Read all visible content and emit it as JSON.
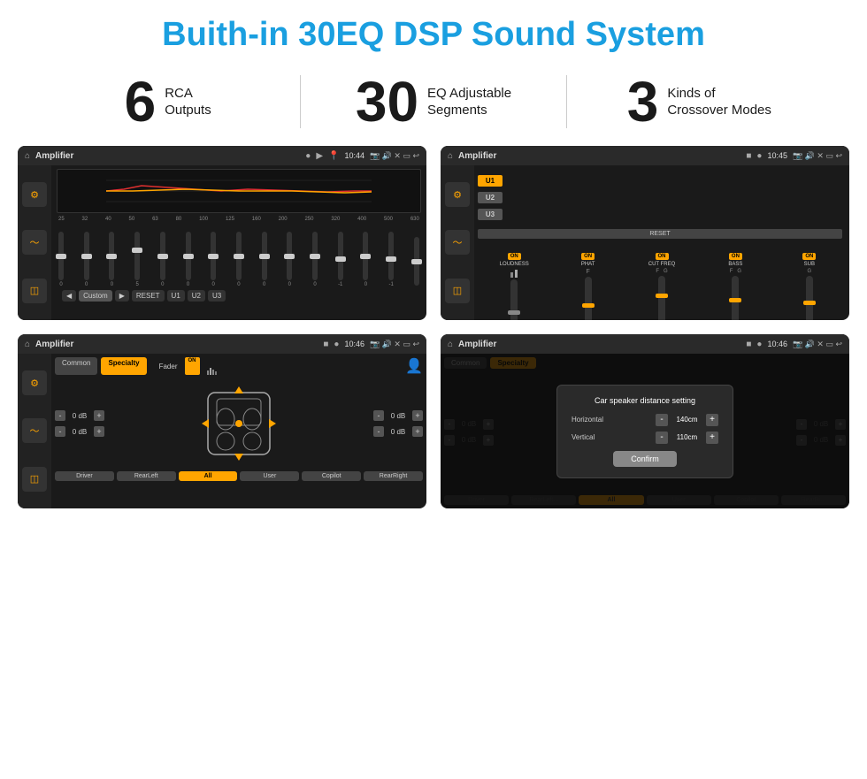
{
  "title": "Buith-in 30EQ DSP Sound System",
  "stats": [
    {
      "number": "6",
      "line1": "RCA",
      "line2": "Outputs"
    },
    {
      "number": "30",
      "line1": "EQ Adjustable",
      "line2": "Segments"
    },
    {
      "number": "3",
      "line1": "Kinds of",
      "line2": "Crossover Modes"
    }
  ],
  "screens": [
    {
      "id": "screen1",
      "topbar": {
        "title": "Amplifier",
        "time": "10:44"
      },
      "type": "eq",
      "freqs": [
        "25",
        "32",
        "40",
        "50",
        "63",
        "80",
        "100",
        "125",
        "160",
        "200",
        "250",
        "320",
        "400",
        "500",
        "630"
      ],
      "vals": [
        "0",
        "0",
        "0",
        "5",
        "0",
        "0",
        "0",
        "0",
        "0",
        "0",
        "0",
        "-1",
        "0",
        "-1"
      ],
      "buttons": [
        "Custom",
        "RESET",
        "U1",
        "U2",
        "U3"
      ]
    },
    {
      "id": "screen2",
      "topbar": {
        "title": "Amplifier",
        "time": "10:45"
      },
      "type": "amplifier",
      "presets": [
        "U1",
        "U2",
        "U3"
      ],
      "controls": [
        "LOUDNESS",
        "PHAT",
        "CUT FREQ",
        "BASS",
        "SUB"
      ],
      "resetLabel": "RESET"
    },
    {
      "id": "screen3",
      "topbar": {
        "title": "Amplifier",
        "time": "10:46"
      },
      "type": "speaker",
      "tabs": [
        "Common",
        "Specialty"
      ],
      "faderLabel": "Fader",
      "faderOn": "ON",
      "dbValues": [
        "0 dB",
        "0 dB",
        "0 dB",
        "0 dB"
      ],
      "buttons": [
        "Driver",
        "RearLeft",
        "All",
        "User",
        "Copilot",
        "RearRight"
      ]
    },
    {
      "id": "screen4",
      "topbar": {
        "title": "Amplifier",
        "time": "10:46"
      },
      "type": "dialog",
      "tabs": [
        "Common",
        "Specialty"
      ],
      "dialog": {
        "title": "Car speaker distance setting",
        "horizontal": {
          "label": "Horizontal",
          "value": "140cm"
        },
        "vertical": {
          "label": "Vertical",
          "value": "110cm"
        },
        "dbValues": [
          "0 dB",
          "0 dB"
        ],
        "confirmLabel": "Confirm"
      }
    }
  ]
}
